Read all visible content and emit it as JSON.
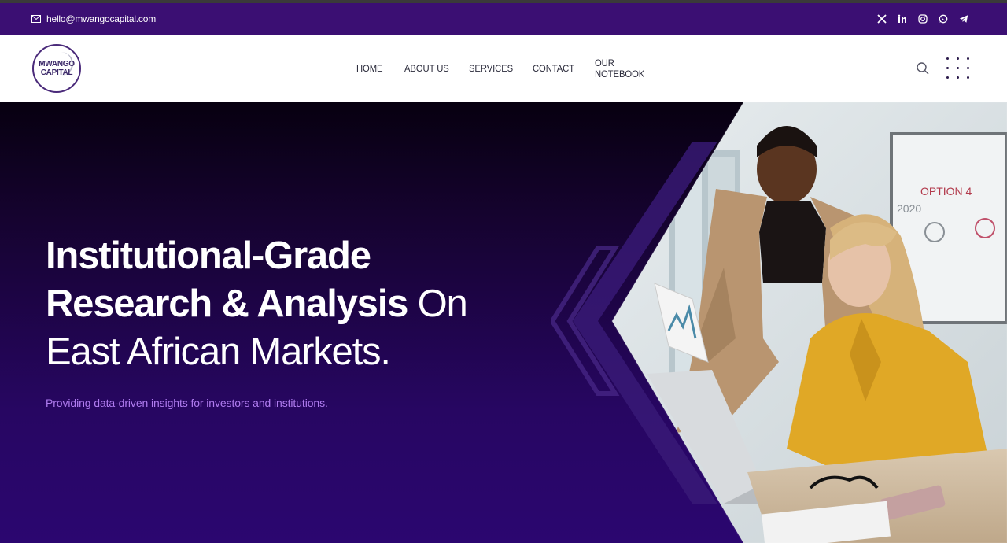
{
  "topbar": {
    "email": "hello@mwangocapital.com",
    "social_icons": [
      "x-icon",
      "linkedin-icon",
      "instagram-icon",
      "whatsapp-icon",
      "telegram-icon"
    ]
  },
  "logo": {
    "line1": "MWANGO",
    "line2": "CAPITAL"
  },
  "nav": {
    "items": [
      {
        "label": "HOME"
      },
      {
        "label": "ABOUT US"
      },
      {
        "label": "SERVICES"
      },
      {
        "label": "CONTACT"
      },
      {
        "label": "OUR NOTEBOOK"
      }
    ]
  },
  "hero": {
    "heading_bold_1": "Institutional-Grade",
    "heading_bold_2": "Research & Analysis",
    "heading_light_1": "On",
    "heading_light_2": "East African Markets.",
    "subtitle": "Providing data-driven insights for investors and institutions."
  },
  "colors": {
    "topbar_bg": "#3b0f73",
    "hero_accent": "#b07cf0",
    "nav_text": "#2a2a3a",
    "hero_bg": "#270662"
  }
}
